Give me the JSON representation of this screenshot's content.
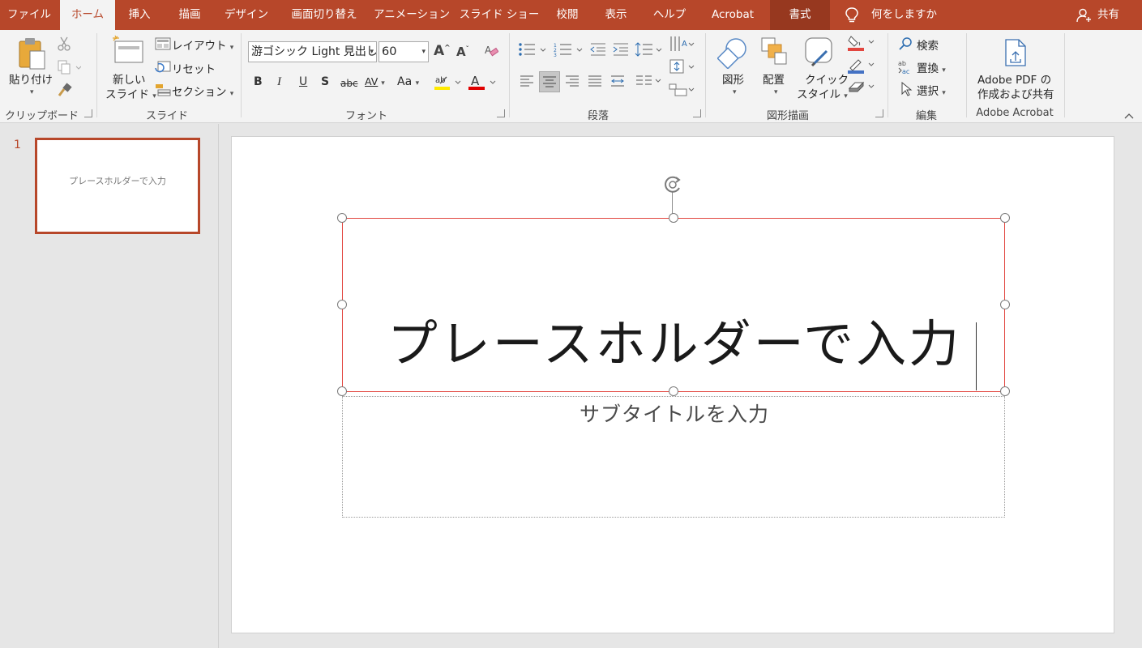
{
  "tabs": [
    {
      "label": "ファイル"
    },
    {
      "label": "ホーム"
    },
    {
      "label": "挿入"
    },
    {
      "label": "描画"
    },
    {
      "label": "デザイン"
    },
    {
      "label": "画面切り替え"
    },
    {
      "label": "アニメーション"
    },
    {
      "label": "スライド ショー"
    },
    {
      "label": "校閲"
    },
    {
      "label": "表示"
    },
    {
      "label": "ヘルプ"
    },
    {
      "label": "Acrobat"
    },
    {
      "label": "書式"
    }
  ],
  "tell_me": "何をしますか",
  "share": "共有",
  "ribbon": {
    "clipboard": {
      "paste": "貼り付け",
      "label": "クリップボード"
    },
    "slides": {
      "new_slide_1": "新しい",
      "new_slide_2": "スライド",
      "layout": "レイアウト",
      "reset": "リセット",
      "section": "セクション",
      "label": "スライド"
    },
    "font": {
      "font_name": "游ゴシック Light 見出し",
      "font_size": "60",
      "bold": "B",
      "italic": "I",
      "underline": "U",
      "shadow": "S",
      "strike": "abc",
      "spacing": "AV",
      "case": "Aa",
      "label": "フォント"
    },
    "paragraph": {
      "label": "段落"
    },
    "drawing": {
      "shapes": "図形",
      "arrange": "配置",
      "quick_styles_1": "クイック",
      "quick_styles_2": "スタイル",
      "label": "図形描画"
    },
    "editing": {
      "find": "検索",
      "replace": "置換",
      "select": "選択",
      "label": "編集"
    },
    "acrobat": {
      "pdf_1": "Adobe PDF の",
      "pdf_2": "作成および共有",
      "label": "Adobe Acrobat"
    }
  },
  "thumbnails": {
    "slide_number": "1",
    "slide_title": "プレースホルダーで入力"
  },
  "slide": {
    "title": "プレースホルダーで入力",
    "subtitle": "サブタイトルを入力"
  },
  "colors": {
    "accent": "#b7472a",
    "selection_border": "#e2463f"
  }
}
